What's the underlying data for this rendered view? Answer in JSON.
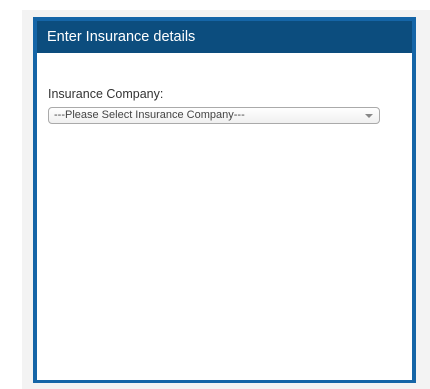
{
  "panel": {
    "title": "Enter Insurance details"
  },
  "form": {
    "insurance_company": {
      "label": "Insurance Company:",
      "selected_value": "---Please Select Insurance Company---"
    }
  },
  "colors": {
    "header_bg": "#0c4d7e",
    "panel_border": "#1565a7",
    "page_bg": "#f3f3f3"
  }
}
